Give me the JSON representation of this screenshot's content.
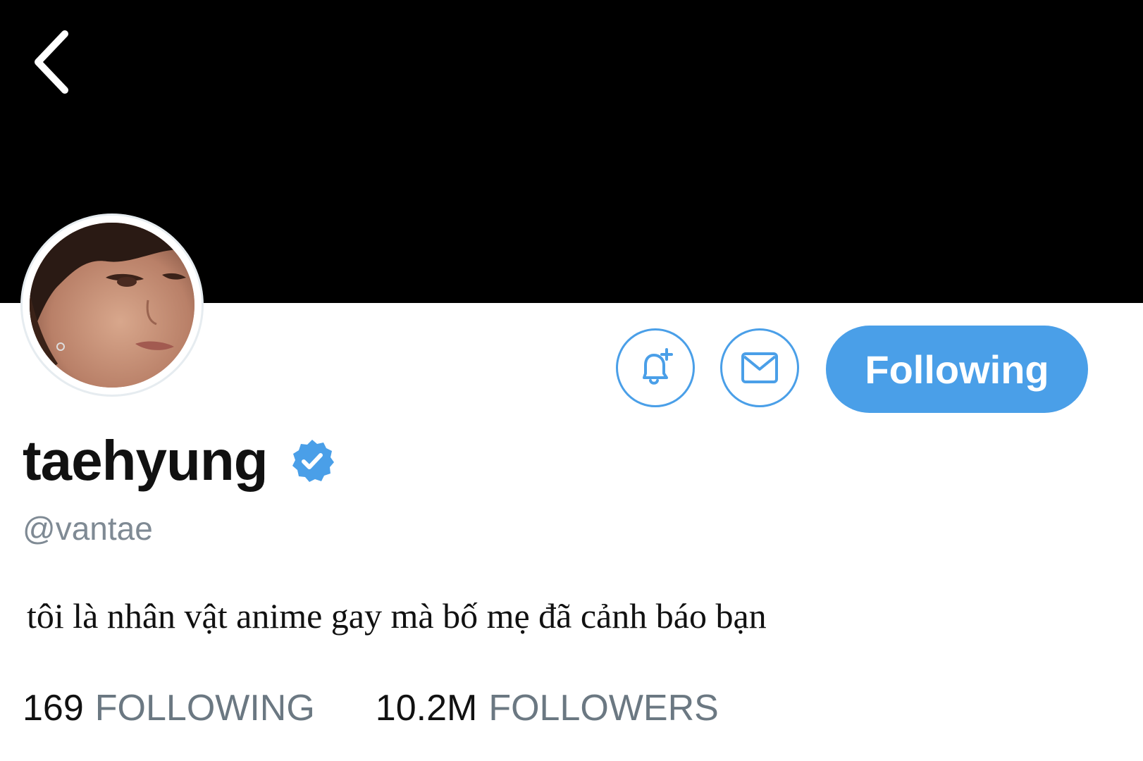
{
  "profile": {
    "display_name": "taehyung",
    "handle": "@vantae",
    "bio": "tôi là nhân vật anime gay mà bố mẹ đã cảnh báo bạn",
    "verified": true
  },
  "actions": {
    "notify_icon": "bell-plus-icon",
    "message_icon": "envelope-icon",
    "follow_label": "Following"
  },
  "stats": {
    "following_count": "169",
    "following_label": "FOLLOWING",
    "followers_count": "10.2M",
    "followers_label": "FOLLOWERS"
  },
  "colors": {
    "accent": "#4a9fe8",
    "banner": "#000000",
    "muted_text": "#7f8a94"
  }
}
